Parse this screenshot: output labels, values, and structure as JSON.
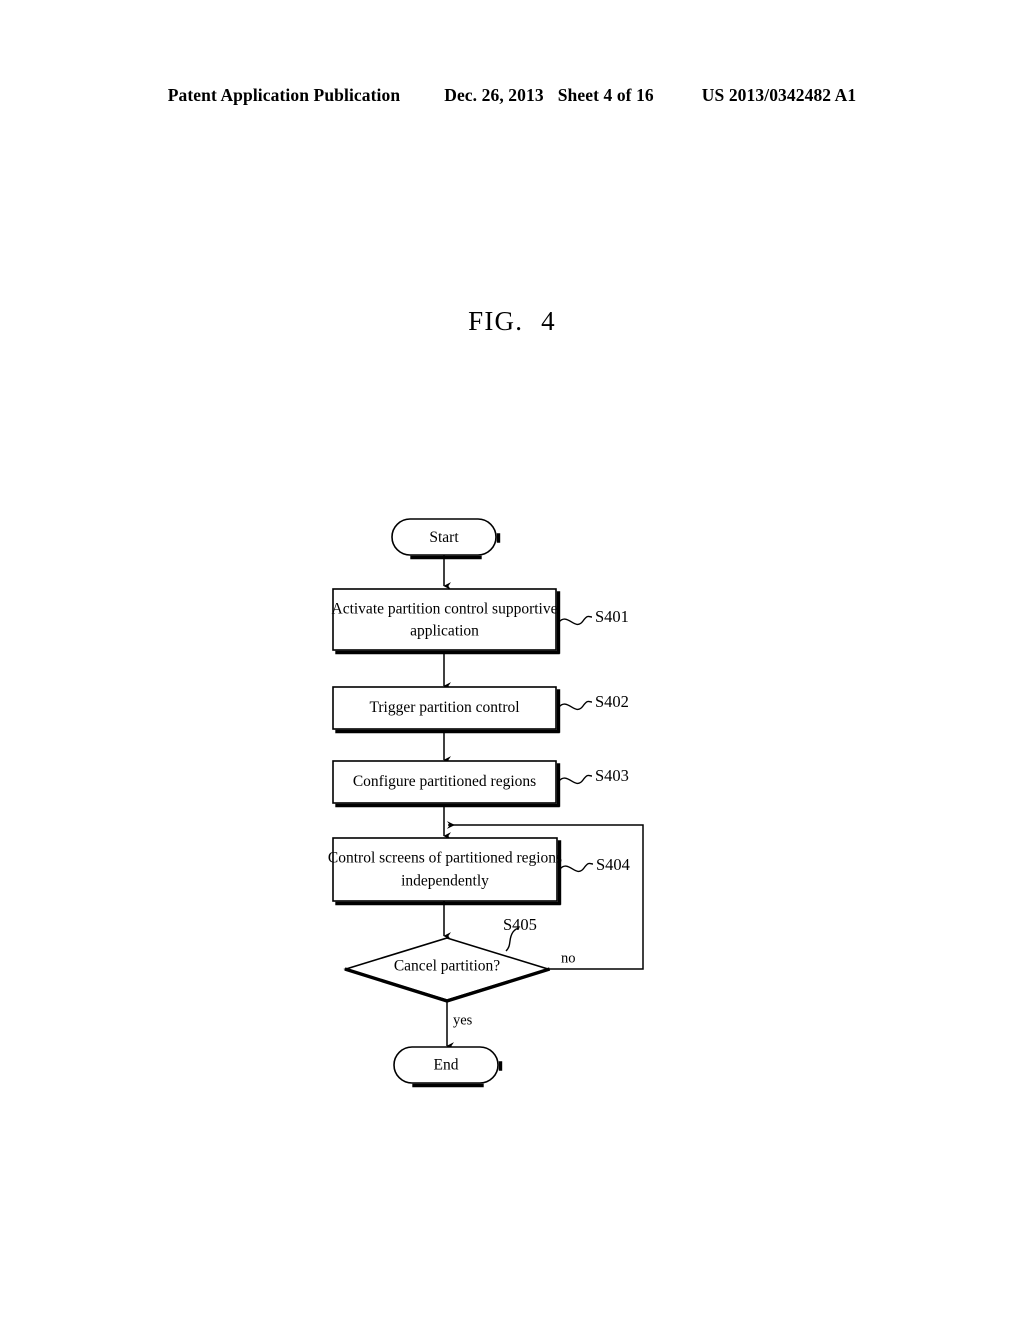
{
  "header": {
    "publication": "Patent Application Publication",
    "date": "Dec. 26, 2013",
    "sheet": "Sheet 4 of 16",
    "patent_number": "US 2013/0342482 A1"
  },
  "figure": {
    "label": "FIG.",
    "number": "4"
  },
  "flowchart": {
    "nodes": {
      "start": "Start",
      "s401_line1": "Activate partition control supportive",
      "s401_line2": "application",
      "s402": "Trigger partition control",
      "s403": "Configure partitioned regions",
      "s404_line1": "Control screens of partitioned regions",
      "s404_line2": "independently",
      "s405": "Cancel partition?",
      "end": "End"
    },
    "step_labels": {
      "s401": "S401",
      "s402": "S402",
      "s403": "S403",
      "s404": "S404",
      "s405": "S405"
    },
    "branch_labels": {
      "no": "no",
      "yes": "yes"
    }
  },
  "colors": {
    "ink": "#000000",
    "paper": "#ffffff"
  }
}
